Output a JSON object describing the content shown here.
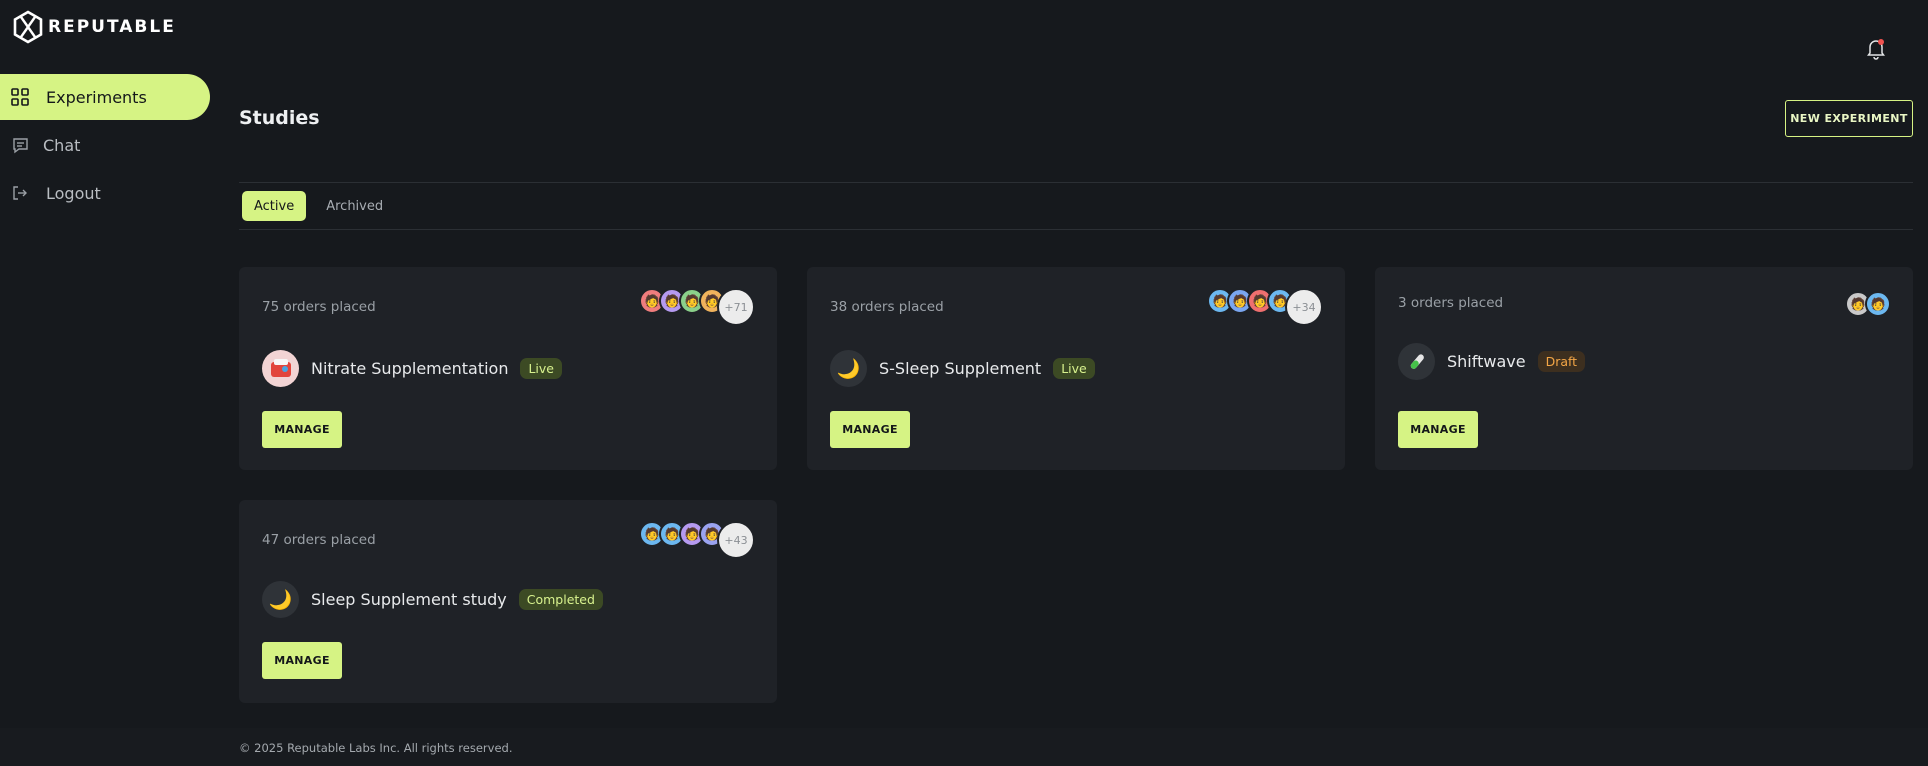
{
  "brand": {
    "name": "REPUTABLE"
  },
  "sidebar": {
    "items": [
      {
        "label": "Experiments",
        "icon": "grid-icon",
        "active": true
      },
      {
        "label": "Chat",
        "icon": "chat-icon",
        "active": false
      },
      {
        "label": "Logout",
        "icon": "logout-icon",
        "active": false
      }
    ]
  },
  "header": {
    "title": "Studies",
    "new_button": "NEW EXPERIMENT",
    "notification_icon": "bell-icon"
  },
  "tabs": [
    {
      "label": "Active",
      "active": true
    },
    {
      "label": "Archived",
      "active": false
    }
  ],
  "studies": [
    {
      "orders": "75 orders placed",
      "name": "Nitrate Supplementation",
      "status": "Live",
      "icon": "nitrate-icon",
      "avatars": [
        "🧑",
        "🧑",
        "🧑",
        "🧑"
      ],
      "extra_count": "+71",
      "action": "MANAGE"
    },
    {
      "orders": "38 orders placed",
      "name": "S-Sleep Supplement",
      "status": "Live",
      "icon": "moon-icon",
      "avatars": [
        "🧑",
        "🧑",
        "🧑",
        "🧑"
      ],
      "extra_count": "+34",
      "action": "MANAGE"
    },
    {
      "orders": "3 orders placed",
      "name": "Shiftwave",
      "status": "Draft",
      "icon": "test-tube-icon",
      "avatars": [
        "🧑",
        "🧑"
      ],
      "extra_count": "",
      "action": "MANAGE"
    },
    {
      "orders": "47 orders placed",
      "name": "Sleep Supplement study",
      "status": "Completed",
      "icon": "moon-icon",
      "avatars": [
        "🧑",
        "🧑",
        "🧑",
        "🧑"
      ],
      "extra_count": "+43",
      "action": "MANAGE"
    }
  ],
  "footer": {
    "text": "© 2025 Reputable Labs Inc. All rights reserved."
  },
  "colors": {
    "accent": "#d6f384",
    "background": "#16191d",
    "card": "#1f2227",
    "draft": "#f4a646"
  }
}
